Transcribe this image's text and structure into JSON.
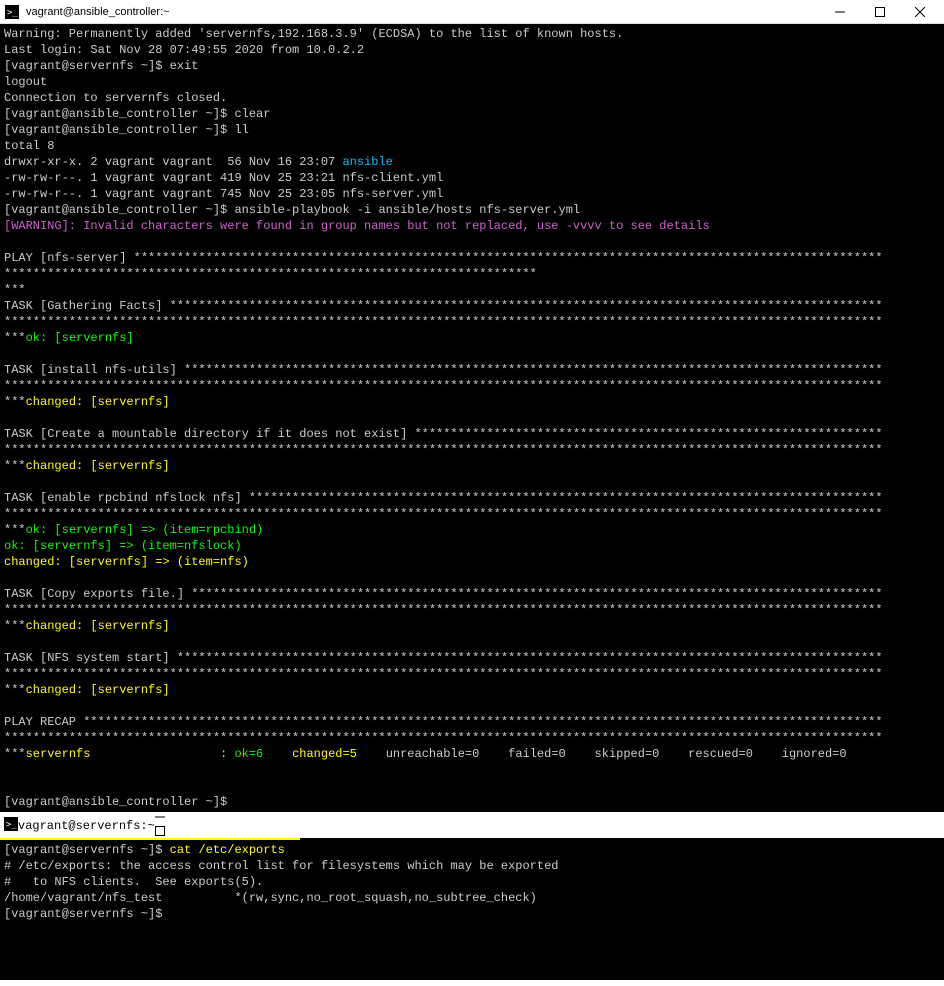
{
  "window1": {
    "title": "vagrant@ansible_controller:~",
    "lines": [
      {
        "segs": [
          {
            "t": "Warning: Permanently added 'servernfs,192.168.3.9' (ECDSA) to the list of known hosts.",
            "c": "white"
          }
        ]
      },
      {
        "segs": [
          {
            "t": "Last login: Sat Nov 28 07:49:55 2020 from 10.0.2.2",
            "c": "white"
          }
        ]
      },
      {
        "segs": [
          {
            "t": "[vagrant@servernfs ~]$ exit",
            "c": "white"
          }
        ]
      },
      {
        "segs": [
          {
            "t": "logout",
            "c": "white"
          }
        ]
      },
      {
        "segs": [
          {
            "t": "Connection to servernfs closed.",
            "c": "white"
          }
        ]
      },
      {
        "segs": [
          {
            "t": "[vagrant@ansible_controller ~]$ clear",
            "c": "white"
          }
        ]
      },
      {
        "segs": [
          {
            "t": "[vagrant@ansible_controller ~]$ ll",
            "c": "white"
          }
        ]
      },
      {
        "segs": [
          {
            "t": "total 8",
            "c": "white"
          }
        ]
      },
      {
        "segs": [
          {
            "t": "drwxr-xr-x. 2 vagrant vagrant  56 Nov 16 23:07 ",
            "c": "white"
          },
          {
            "t": "ansible",
            "c": "cyan"
          }
        ]
      },
      {
        "segs": [
          {
            "t": "-rw-rw-r--. 1 vagrant vagrant 419 Nov 25 23:21 nfs-client.yml",
            "c": "white"
          }
        ]
      },
      {
        "segs": [
          {
            "t": "-rw-rw-r--. 1 vagrant vagrant 745 Nov 25 23:05 nfs-server.yml",
            "c": "white"
          }
        ]
      },
      {
        "segs": [
          {
            "t": "[vagrant@ansible_controller ~]$ ansible-playbook -i ansible/hosts nfs-server.yml",
            "c": "white"
          }
        ]
      },
      {
        "segs": [
          {
            "t": "[WARNING]: Invalid characters were found in group names but not replaced, use -vvvv to see details",
            "c": "magenta"
          }
        ]
      },
      {
        "segs": [
          {
            "t": " ",
            "c": "white"
          }
        ]
      },
      {
        "segs": [
          {
            "t": "PLAY [nfs-server] ********************************************************************************************************",
            "c": "white"
          }
        ]
      },
      {
        "segs": [
          {
            "t": "**************************************************************************",
            "c": "white"
          }
        ]
      },
      {
        "segs": [
          {
            "t": "***",
            "c": "white"
          }
        ]
      },
      {
        "segs": [
          {
            "t": "TASK [Gathering Facts] ***************************************************************************************************",
            "c": "white"
          }
        ]
      },
      {
        "segs": [
          {
            "t": "**************************************************************************************************************************",
            "c": "white"
          }
        ]
      },
      {
        "segs": [
          {
            "t": "***",
            "c": "white"
          },
          {
            "t": "ok: [servernfs]",
            "c": "green"
          }
        ]
      },
      {
        "segs": [
          {
            "t": " ",
            "c": "white"
          }
        ]
      },
      {
        "segs": [
          {
            "t": "TASK [install nfs-utils] *************************************************************************************************",
            "c": "white"
          }
        ]
      },
      {
        "segs": [
          {
            "t": "**************************************************************************************************************************",
            "c": "white"
          }
        ]
      },
      {
        "segs": [
          {
            "t": "***",
            "c": "white"
          },
          {
            "t": "changed: [servernfs]",
            "c": "yellow"
          }
        ]
      },
      {
        "segs": [
          {
            "t": " ",
            "c": "white"
          }
        ]
      },
      {
        "segs": [
          {
            "t": "TASK [Create a mountable directory if it does not exist] *****************************************************************",
            "c": "white"
          }
        ]
      },
      {
        "segs": [
          {
            "t": "**************************************************************************************************************************",
            "c": "white"
          }
        ]
      },
      {
        "segs": [
          {
            "t": "***",
            "c": "white"
          },
          {
            "t": "changed: [servernfs]",
            "c": "yellow"
          }
        ]
      },
      {
        "segs": [
          {
            "t": " ",
            "c": "white"
          }
        ]
      },
      {
        "segs": [
          {
            "t": "TASK [enable rpcbind nfslock nfs] ****************************************************************************************",
            "c": "white"
          }
        ]
      },
      {
        "segs": [
          {
            "t": "**************************************************************************************************************************",
            "c": "white"
          }
        ]
      },
      {
        "segs": [
          {
            "t": "***",
            "c": "white"
          },
          {
            "t": "ok: [servernfs] => (item=rpcbind)",
            "c": "green"
          }
        ]
      },
      {
        "segs": [
          {
            "t": "ok: [servernfs] => (item=nfslock)",
            "c": "green"
          }
        ]
      },
      {
        "segs": [
          {
            "t": "changed: [servernfs] => (item=nfs)",
            "c": "yellow"
          }
        ]
      },
      {
        "segs": [
          {
            "t": " ",
            "c": "white"
          }
        ]
      },
      {
        "segs": [
          {
            "t": "TASK [Copy exports file.] ************************************************************************************************",
            "c": "white"
          }
        ]
      },
      {
        "segs": [
          {
            "t": "**************************************************************************************************************************",
            "c": "white"
          }
        ]
      },
      {
        "segs": [
          {
            "t": "***",
            "c": "white"
          },
          {
            "t": "changed: [servernfs]",
            "c": "yellow"
          }
        ]
      },
      {
        "segs": [
          {
            "t": " ",
            "c": "white"
          }
        ]
      },
      {
        "segs": [
          {
            "t": "TASK [NFS system start] **************************************************************************************************",
            "c": "white"
          }
        ]
      },
      {
        "segs": [
          {
            "t": "**************************************************************************************************************************",
            "c": "white"
          }
        ]
      },
      {
        "segs": [
          {
            "t": "***",
            "c": "white"
          },
          {
            "t": "changed: [servernfs]",
            "c": "yellow"
          }
        ]
      },
      {
        "segs": [
          {
            "t": " ",
            "c": "white"
          }
        ]
      },
      {
        "segs": [
          {
            "t": "PLAY RECAP ***************************************************************************************************************",
            "c": "white"
          }
        ]
      },
      {
        "segs": [
          {
            "t": "**************************************************************************************************************************",
            "c": "white"
          }
        ]
      },
      {
        "segs": [
          {
            "t": "***",
            "c": "white"
          },
          {
            "t": "servernfs                  ",
            "c": "yellow"
          },
          {
            "t": ": ",
            "c": "white"
          },
          {
            "t": "ok=6   ",
            "c": "green"
          },
          {
            "t": " ",
            "c": "white"
          },
          {
            "t": "changed=5   ",
            "c": "yellow"
          },
          {
            "t": " unreachable=0    failed=0    skipped=0    rescued=0    ignored=0",
            "c": "white"
          }
        ]
      },
      {
        "segs": [
          {
            "t": " ",
            "c": "white"
          }
        ]
      },
      {
        "segs": [
          {
            "t": " ",
            "c": "white"
          }
        ]
      },
      {
        "segs": [
          {
            "t": "[vagrant@ansible_controller ~]$",
            "c": "white"
          }
        ]
      }
    ]
  },
  "window2": {
    "title": "vagrant@servernfs:~",
    "lines": [
      {
        "segs": [
          {
            "t": "[vagrant@servernfs ~]$ ",
            "c": "white"
          },
          {
            "t": "cat /etc/exports",
            "c": "yellow"
          }
        ]
      },
      {
        "segs": [
          {
            "t": "# /etc/exports: the access control list for filesystems which may be exported",
            "c": "white"
          }
        ]
      },
      {
        "segs": [
          {
            "t": "#   to NFS clients.  See exports(5).",
            "c": "white"
          }
        ]
      },
      {
        "segs": [
          {
            "t": "/home/vagrant/nfs_test          *(rw,sync,no_root_squash,no_subtree_check)",
            "c": "white"
          }
        ]
      },
      {
        "segs": [
          {
            "t": "[vagrant@servernfs ~]$",
            "c": "white"
          }
        ]
      }
    ]
  }
}
